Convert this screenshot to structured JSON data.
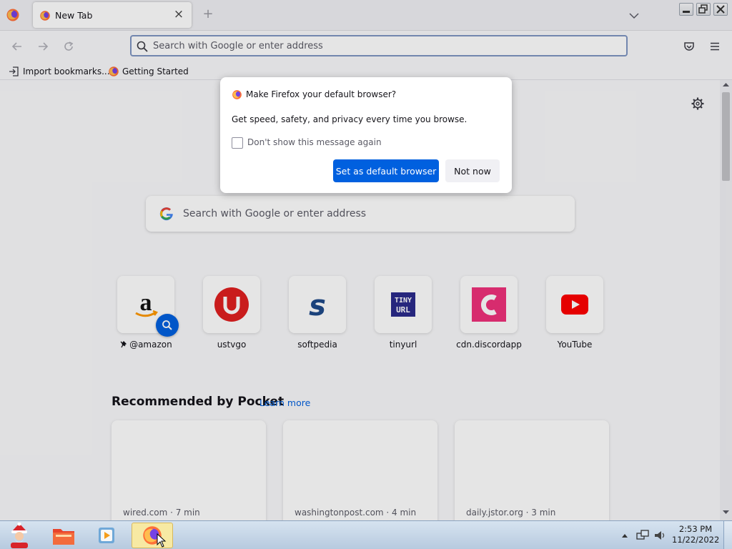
{
  "tab_strip": {
    "tabs": [
      {
        "title": "New Tab"
      }
    ],
    "close_glyph": "×",
    "new_tab_glyph": "+"
  },
  "nav": {
    "url_placeholder": "Search with Google or enter address"
  },
  "bookmarks": [
    {
      "label": "Import bookmarks...",
      "icon": "import-icon"
    },
    {
      "label": "Getting Started",
      "icon": "firefox-icon"
    }
  ],
  "dialog": {
    "title": "Make Firefox your default browser?",
    "body": "Get speed, safety, and privacy every time you browse.",
    "checkbox_label": "Don't show this message again",
    "checkbox_checked": false,
    "primary_button": "Set as default browser",
    "secondary_button": "Not now"
  },
  "newtab": {
    "search_placeholder": "Search with Google or enter address",
    "top_sites": [
      {
        "label": "@amazon",
        "icon": "amazon-icon",
        "pinned": true
      },
      {
        "label": "ustvgo",
        "icon": "ustvgo-icon"
      },
      {
        "label": "softpedia",
        "icon": "softpedia-icon"
      },
      {
        "label": "tinyurl",
        "icon": "tinyurl-icon"
      },
      {
        "label": "cdn.discordapp",
        "icon": "discord-icon"
      },
      {
        "label": "YouTube",
        "icon": "youtube-icon"
      }
    ],
    "pocket": {
      "title": "Recommended by Pocket",
      "learn_more": "Learn more",
      "cards": [
        {
          "source": "wired.com · 7 min"
        },
        {
          "source": "washingtonpost.com · 4 min"
        },
        {
          "source": "daily.jstor.org · 3 min"
        }
      ]
    }
  },
  "taskbar": {
    "time": "2:53 PM",
    "date": "11/22/2022"
  },
  "colors": {
    "accent": "#0060df",
    "firefox_orange": "#ff7139",
    "firefox_purple": "#7542e5"
  }
}
